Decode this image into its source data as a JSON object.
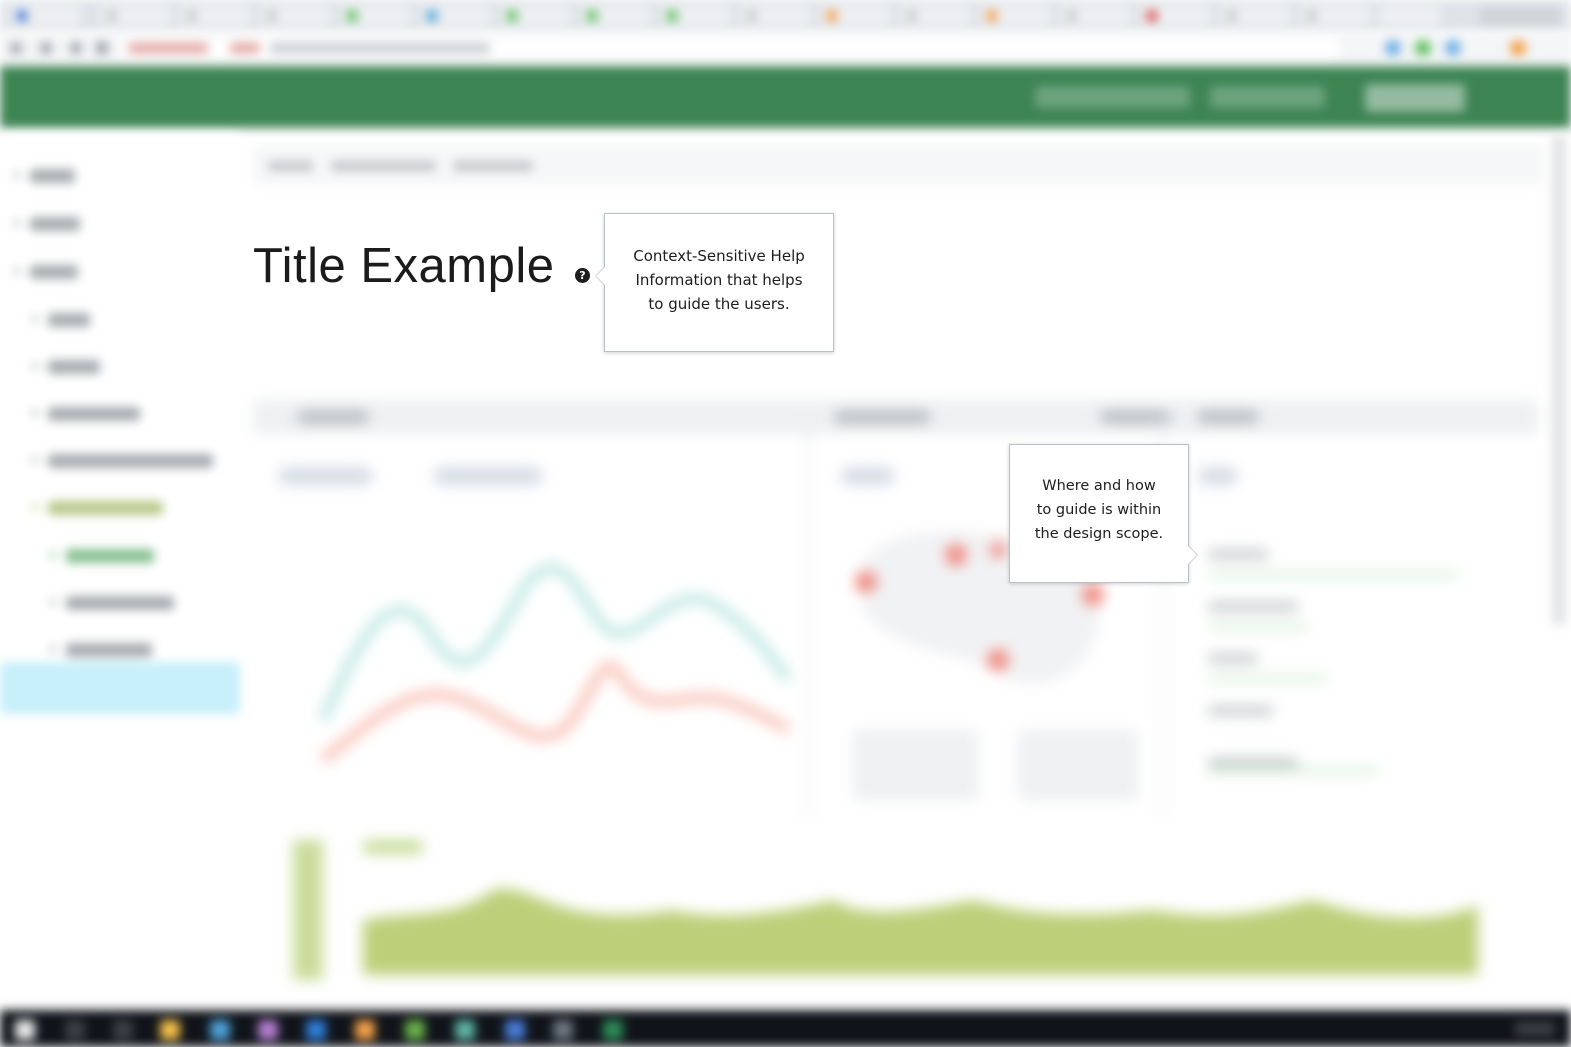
{
  "page": {
    "title": "Title Example"
  },
  "help": {
    "icon_glyph": "?",
    "icon": "question-circle-icon"
  },
  "tooltips": {
    "help": [
      "Context-Sensitive Help",
      "Information that helps",
      "to guide the users."
    ],
    "scope": [
      "Where and how",
      "to guide is within",
      "the design scope."
    ]
  },
  "colors": {
    "header_green": "#3d8453",
    "active_nav": "#c7f0fb",
    "series_teal": "#bfe8e3",
    "series_red": "#f9c2b7",
    "area_green": "#bcd07a",
    "map_marker": "#f08a80"
  }
}
